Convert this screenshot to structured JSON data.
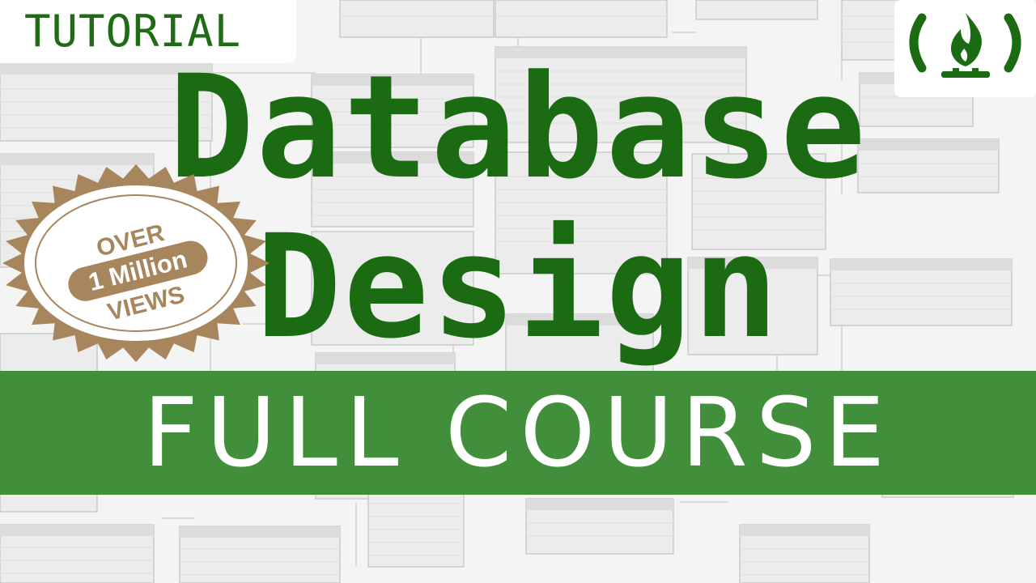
{
  "tag": {
    "label": "TUTORIAL"
  },
  "title": {
    "line1": "Database",
    "line2": "Design"
  },
  "banner": {
    "label": "FULL COURSE"
  },
  "badge": {
    "top": "OVER",
    "middle": "1 Million",
    "bottom": "VIEWS"
  },
  "logo": {
    "icon": "freecodecamp-flame-icon"
  },
  "colors": {
    "title_green": "#1b6b12",
    "banner_green": "#428f3b",
    "badge_gold": "#a7865e",
    "background": "#f4f4f4"
  }
}
